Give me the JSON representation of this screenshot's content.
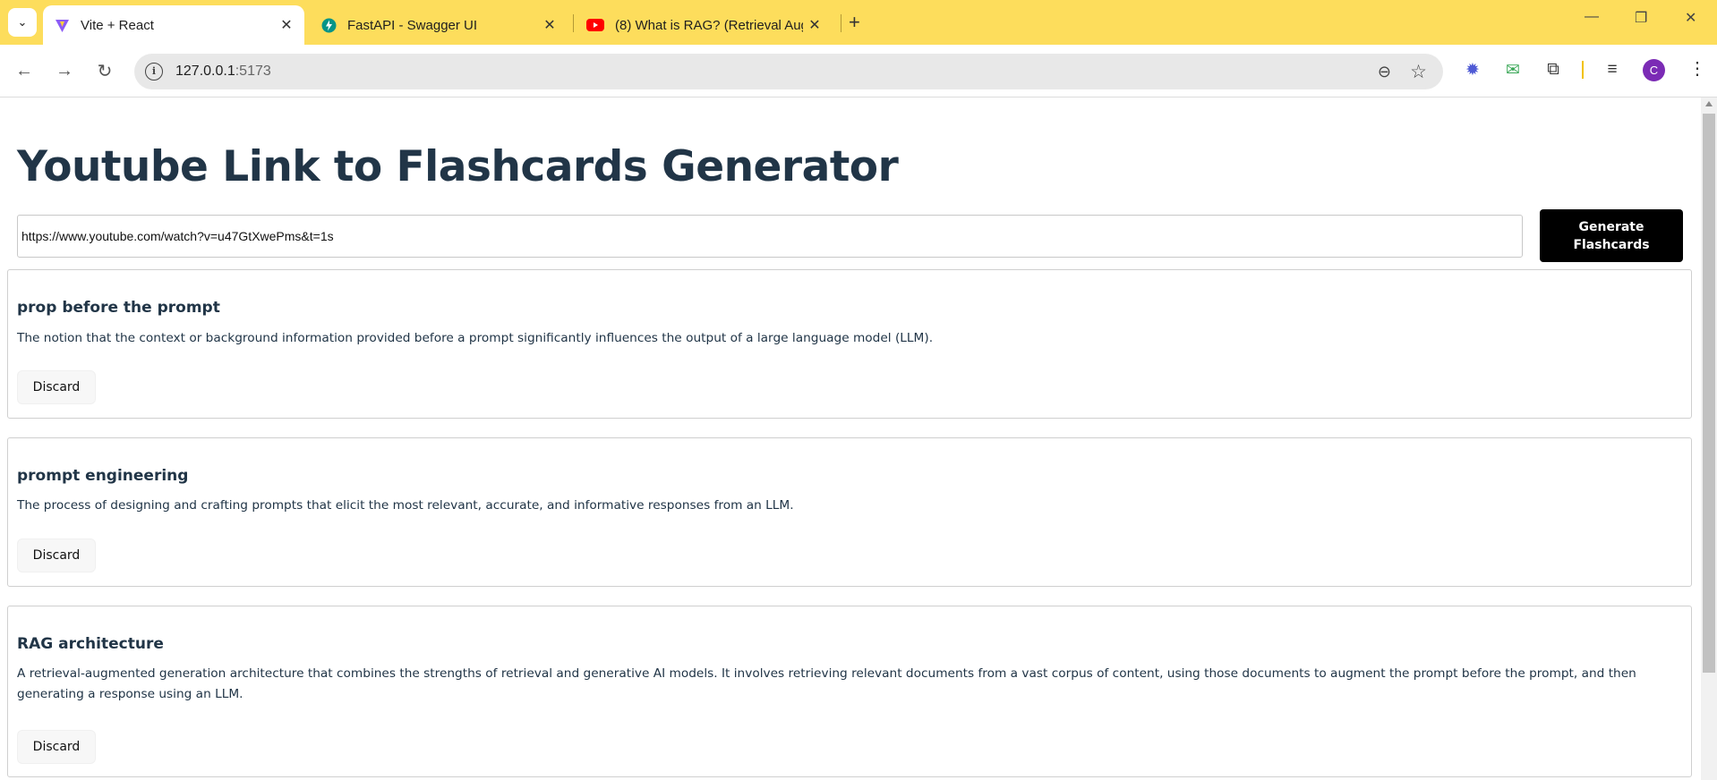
{
  "browser": {
    "tabs": [
      {
        "label": "Vite + React",
        "active": true,
        "favicon": "vite-icon"
      },
      {
        "label": "FastAPI - Swagger UI",
        "active": false,
        "favicon": "fastapi-icon"
      },
      {
        "label": "(8) What is RAG? (Retrieval Aug",
        "active": false,
        "favicon": "youtube-icon"
      }
    ],
    "address": {
      "host": "127.0.0.1",
      "port": ":5173"
    },
    "profile_initial": "C",
    "colors": {
      "tabbar": "#fddd5c",
      "profile": "#7b2bb5"
    }
  },
  "app": {
    "title": "Youtube Link to Flashcards Generator",
    "url_input_value": "https://www.youtube.com/watch?v=u47GtXwePms&t=1s",
    "generate_label": "Generate Flashcards",
    "flashcards": [
      {
        "term": "prop before the prompt",
        "definition": "The notion that the context or background information provided before a prompt significantly influences the output of a large language model (LLM).",
        "discard_label": "Discard"
      },
      {
        "term": "prompt engineering",
        "definition": "The process of designing and crafting prompts that elicit the most relevant, accurate, and informative responses from an LLM.",
        "discard_label": "Discard"
      },
      {
        "term": "RAG architecture",
        "definition": "A retrieval-augmented generation architecture that combines the strengths of retrieval and generative AI models. It involves retrieving relevant documents from a vast corpus of content, using those documents to augment the prompt before the prompt, and then generating a response using an LLM.",
        "discard_label": "Discard"
      }
    ]
  }
}
